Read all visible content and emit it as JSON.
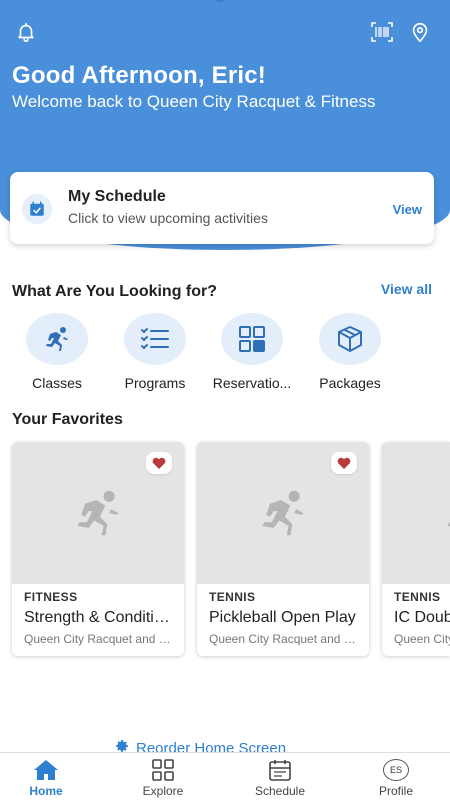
{
  "header": {
    "greeting": "Good Afternoon, Eric!",
    "welcome": "Welcome back to Queen City Racquet & Fitness",
    "icons": [
      "bell-icon",
      "barcode-icon",
      "location-pin-icon"
    ]
  },
  "schedule": {
    "title": "My Schedule",
    "subtitle": "Click to view upcoming activities",
    "view_label": "View"
  },
  "looking_for": {
    "title": "What Are You Looking for?",
    "view_all": "View all",
    "categories": [
      {
        "label": "Classes",
        "icon": "running-person-icon"
      },
      {
        "label": "Programs",
        "icon": "checklist-icon"
      },
      {
        "label": "Reservations",
        "icon": "grid-icon"
      },
      {
        "label": "Packages",
        "icon": "package-box-icon"
      }
    ]
  },
  "favorites": {
    "title": "Your Favorites",
    "items": [
      {
        "category": "FITNESS",
        "name": "Strength & Conditioning",
        "location": "Queen City Racquet and Fitness",
        "favorited": true
      },
      {
        "category": "TENNIS",
        "name": "Pickleball Open Play",
        "location": "Queen City Racquet and Fitness",
        "favorited": true
      },
      {
        "category": "TENNIS",
        "name": "IC Doubles",
        "location": "Queen City Racquet and Fitness",
        "favorited": true
      }
    ]
  },
  "reorder_label": "Reorder Home Screen",
  "nav": {
    "items": [
      {
        "label": "Home",
        "icon": "home-icon",
        "active": true
      },
      {
        "label": "Explore",
        "icon": "explore-grid-icon",
        "active": false
      },
      {
        "label": "Schedule",
        "icon": "calendar-icon",
        "active": false
      },
      {
        "label": "Profile",
        "icon": "avatar",
        "active": false
      }
    ],
    "avatar_initials": "ES"
  },
  "colors": {
    "brand_blue": "#4a8fd9",
    "link_blue": "#2f7fd0",
    "heart_red": "#b83a3a"
  }
}
